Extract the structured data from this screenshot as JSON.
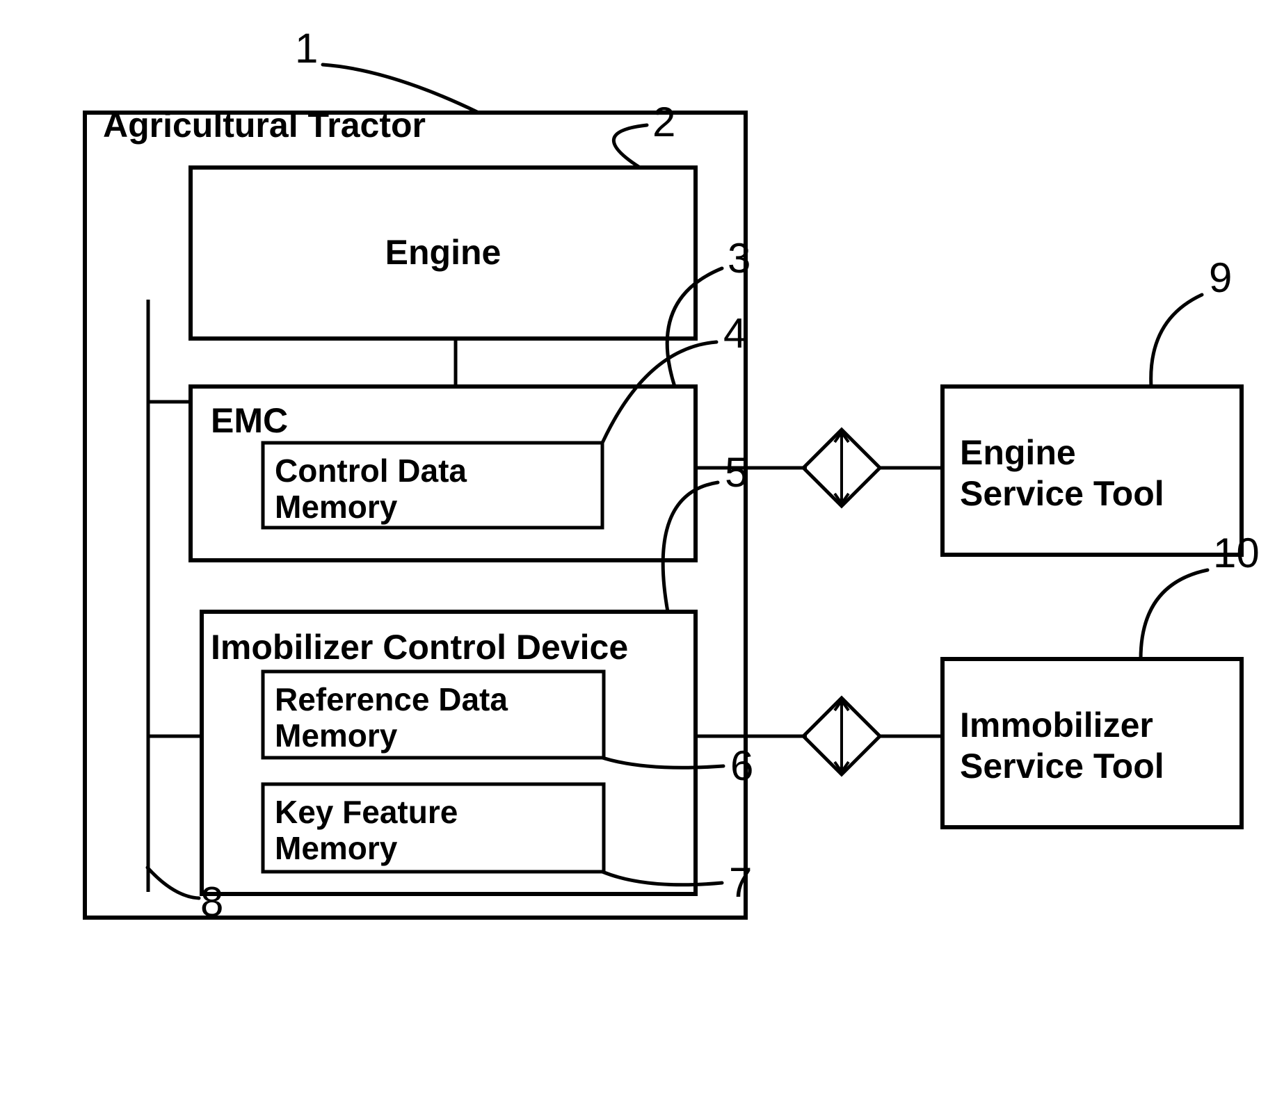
{
  "figure": {
    "type": "patent-block-diagram",
    "background": "#ffffff",
    "line_color": "#000000"
  },
  "blocks": {
    "tractor": {
      "label": "Agricultural Tractor",
      "ref": "1"
    },
    "engine": {
      "label": "Engine",
      "ref": "2"
    },
    "emc": {
      "label": "EMC",
      "ref": "3"
    },
    "control_data_memory": {
      "line1": "Control Data",
      "line2": "Memory",
      "ref": "4"
    },
    "immobilizer_control_device": {
      "label": "Imobilizer Control Device",
      "ref": "5"
    },
    "reference_data_memory": {
      "line1": "Reference Data",
      "line2": "Memory",
      "ref": "6"
    },
    "key_feature_memory": {
      "line1": "Key Feature",
      "line2": "Memory",
      "ref": "7"
    },
    "bus": {
      "ref": "8"
    },
    "engine_service_tool": {
      "line1": "Engine",
      "line2": "Service Tool",
      "ref": "9"
    },
    "immobilizer_service_tool": {
      "line1": "Immobilizer",
      "line2": "Service Tool",
      "ref": "10"
    }
  },
  "reference_numerals": [
    {
      "id": "1",
      "text": "1",
      "target": "Agricultural Tractor"
    },
    {
      "id": "2",
      "text": "2",
      "target": "Engine"
    },
    {
      "id": "3",
      "text": "3",
      "target": "EMC"
    },
    {
      "id": "4",
      "text": "4",
      "target": "Control Data Memory"
    },
    {
      "id": "5",
      "text": "5",
      "target": "Imobilizer Control Device"
    },
    {
      "id": "6",
      "text": "6",
      "target": "Reference Data Memory"
    },
    {
      "id": "7",
      "text": "7",
      "target": "Key Feature Memory"
    },
    {
      "id": "8",
      "text": "8",
      "target": "Vehicle bus"
    },
    {
      "id": "9",
      "text": "9",
      "target": "Engine Service Tool"
    },
    {
      "id": "10",
      "text": "10",
      "target": "Immobilizer Service Tool"
    }
  ],
  "connectors": {
    "engine_to_emc": "vertical link",
    "emc_to_engine_tool": "diamond interface link",
    "immobilizer_to_immobilizer_tool": "diamond interface link",
    "bus_to_emc": "horizontal bus tap",
    "bus_to_immobilizer": "horizontal bus tap"
  }
}
